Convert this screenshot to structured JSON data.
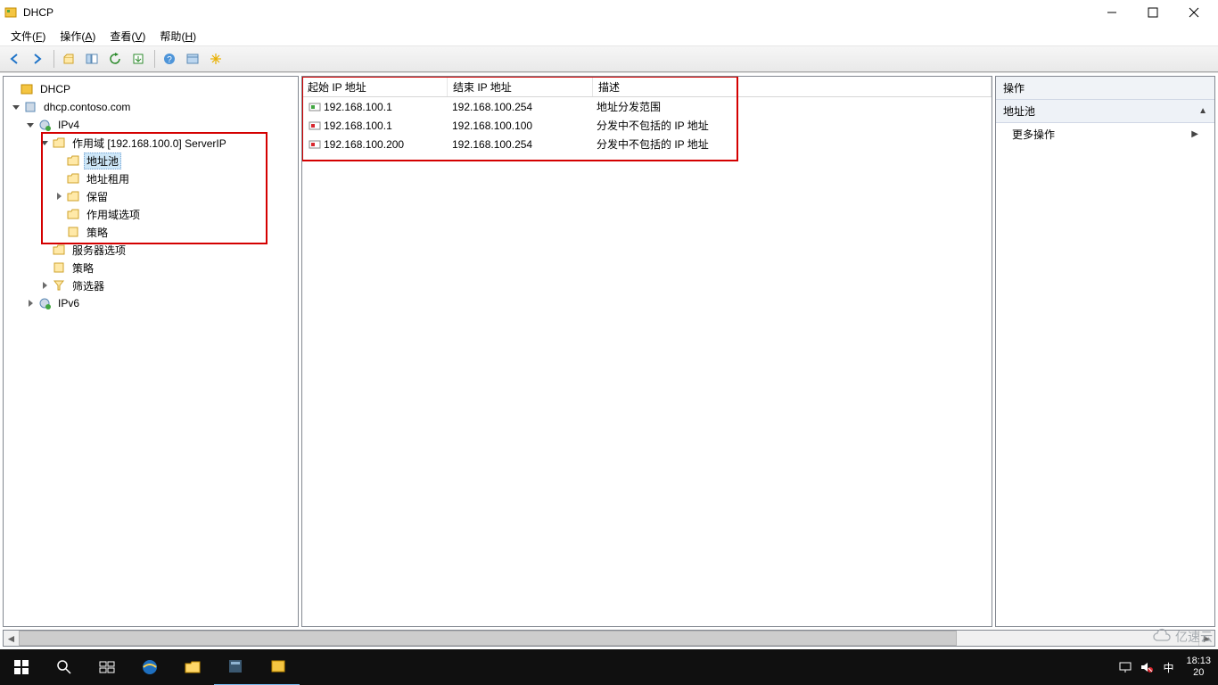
{
  "app": {
    "title": "DHCP"
  },
  "menus": {
    "file": {
      "label": "文件",
      "hot": "F"
    },
    "action": {
      "label": "操作",
      "hot": "A"
    },
    "view": {
      "label": "查看",
      "hot": "V"
    },
    "help": {
      "label": "帮助",
      "hot": "H"
    }
  },
  "tree": {
    "root": "DHCP",
    "server": "dhcp.contoso.com",
    "ipv4": "IPv4",
    "scope": "作用域 [192.168.100.0] ServerIP",
    "pool": "地址池",
    "leases": "地址租用",
    "reservations": "保留",
    "scope_options": "作用域选项",
    "policies": "策略",
    "server_options": "服务器选项",
    "server_policies": "策略",
    "filters": "筛选器",
    "ipv6": "IPv6"
  },
  "list": {
    "headers": {
      "start": "起始 IP 地址",
      "end": "结束 IP 地址",
      "desc": "描述"
    },
    "rows": [
      {
        "start": "192.168.100.1",
        "end": "192.168.100.254",
        "desc": "地址分发范围",
        "type": "range"
      },
      {
        "start": "192.168.100.1",
        "end": "192.168.100.100",
        "desc": "分发中不包括的 IP 地址",
        "type": "exclusion"
      },
      {
        "start": "192.168.100.200",
        "end": "192.168.100.254",
        "desc": "分发中不包括的 IP 地址",
        "type": "exclusion"
      }
    ]
  },
  "actions": {
    "header": "操作",
    "context": "地址池",
    "more": "更多操作"
  },
  "systray": {
    "time": "18:13",
    "date_prefix": "20",
    "ime": "中"
  },
  "watermark": "亿速云"
}
